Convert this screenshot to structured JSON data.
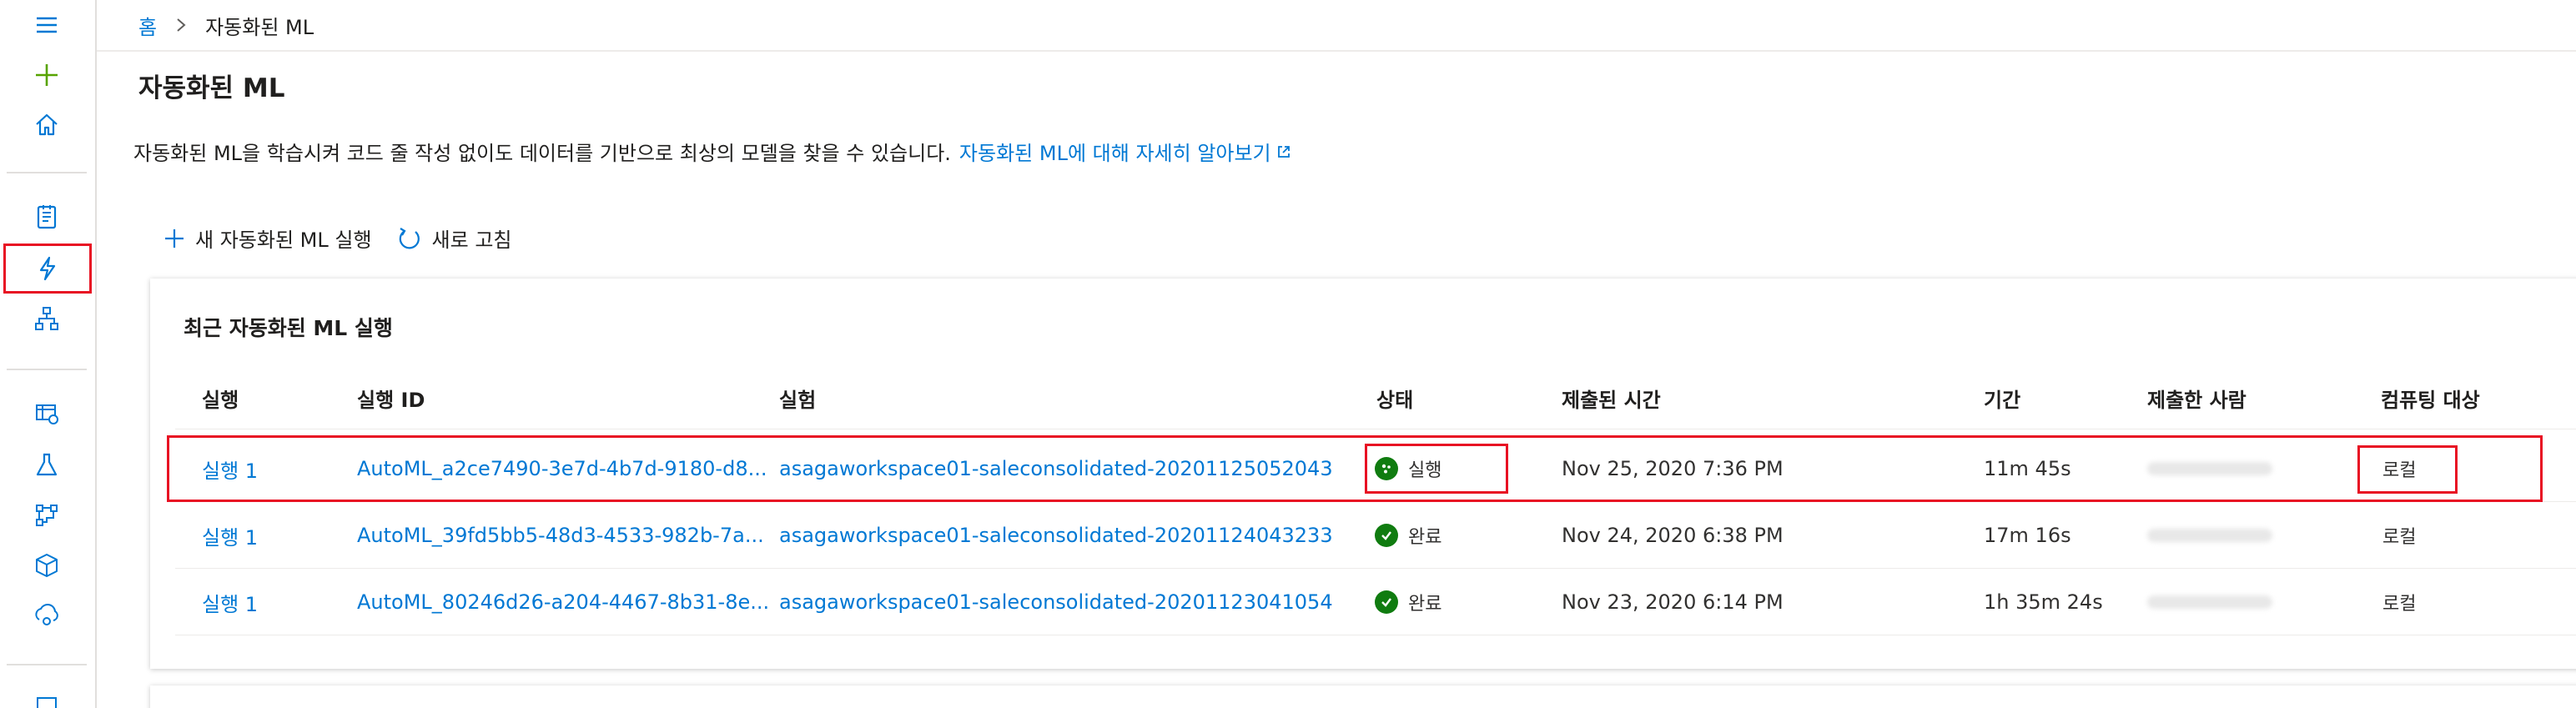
{
  "breadcrumb": {
    "home": "홈",
    "current": "자동화된 ML"
  },
  "page": {
    "title": "자동화된 ML",
    "intro_text": "자동화된 ML을 학습시켜 코드 줄 작성 없이도 데이터를 기반으로 최상의 모델을 찾을 수 있습니다.",
    "intro_link": "자동화된 ML에 대해 자세히 알아보기"
  },
  "toolbar": {
    "new_run": "새 자동화된 ML 실행",
    "refresh": "새로 고침"
  },
  "card": {
    "title": "최근 자동화된 ML 실행"
  },
  "table": {
    "columns": [
      "실행",
      "실행 ID",
      "실험",
      "상태",
      "제출된 시간",
      "기간",
      "제출한 사람",
      "컴퓨팅 대상"
    ],
    "rows": [
      {
        "run": "실행 1",
        "run_id": "AutoML_a2ce7490-3e7d-4b7d-9180-d8...",
        "experiment": "asagaworkspace01-saleconsolidated-20201125052043",
        "status": "실행",
        "submitted": "Nov 25, 2020 7:36 PM",
        "duration": "11m 45s",
        "submitted_by": "",
        "compute": "로컬"
      },
      {
        "run": "실행 1",
        "run_id": "AutoML_39fd5bb5-48d3-4533-982b-7a...",
        "experiment": "asagaworkspace01-saleconsolidated-20201124043233",
        "status": "완료",
        "submitted": "Nov 24, 2020 6:38 PM",
        "duration": "17m 16s",
        "submitted_by": "",
        "compute": "로컬"
      },
      {
        "run": "실행 1",
        "run_id": "AutoML_80246d26-a204-4467-8b31-8e...",
        "experiment": "asagaworkspace01-saleconsolidated-20201123041054",
        "status": "완료",
        "submitted": "Nov 23, 2020 6:14 PM",
        "duration": "1h 35m 24s",
        "submitted_by": "",
        "compute": "로컬"
      }
    ]
  },
  "colors": {
    "accent": "#0078d4",
    "success": "#107c10",
    "highlight": "#e81123",
    "plus": "#57a300"
  },
  "rail_icons": [
    "menu-icon",
    "plus-icon",
    "home-icon",
    "notebook-icon",
    "automl-icon",
    "designer-icon",
    "datasets-icon",
    "experiments-icon",
    "pipelines-icon",
    "models-icon",
    "endpoints-icon",
    "compute-icon"
  ]
}
